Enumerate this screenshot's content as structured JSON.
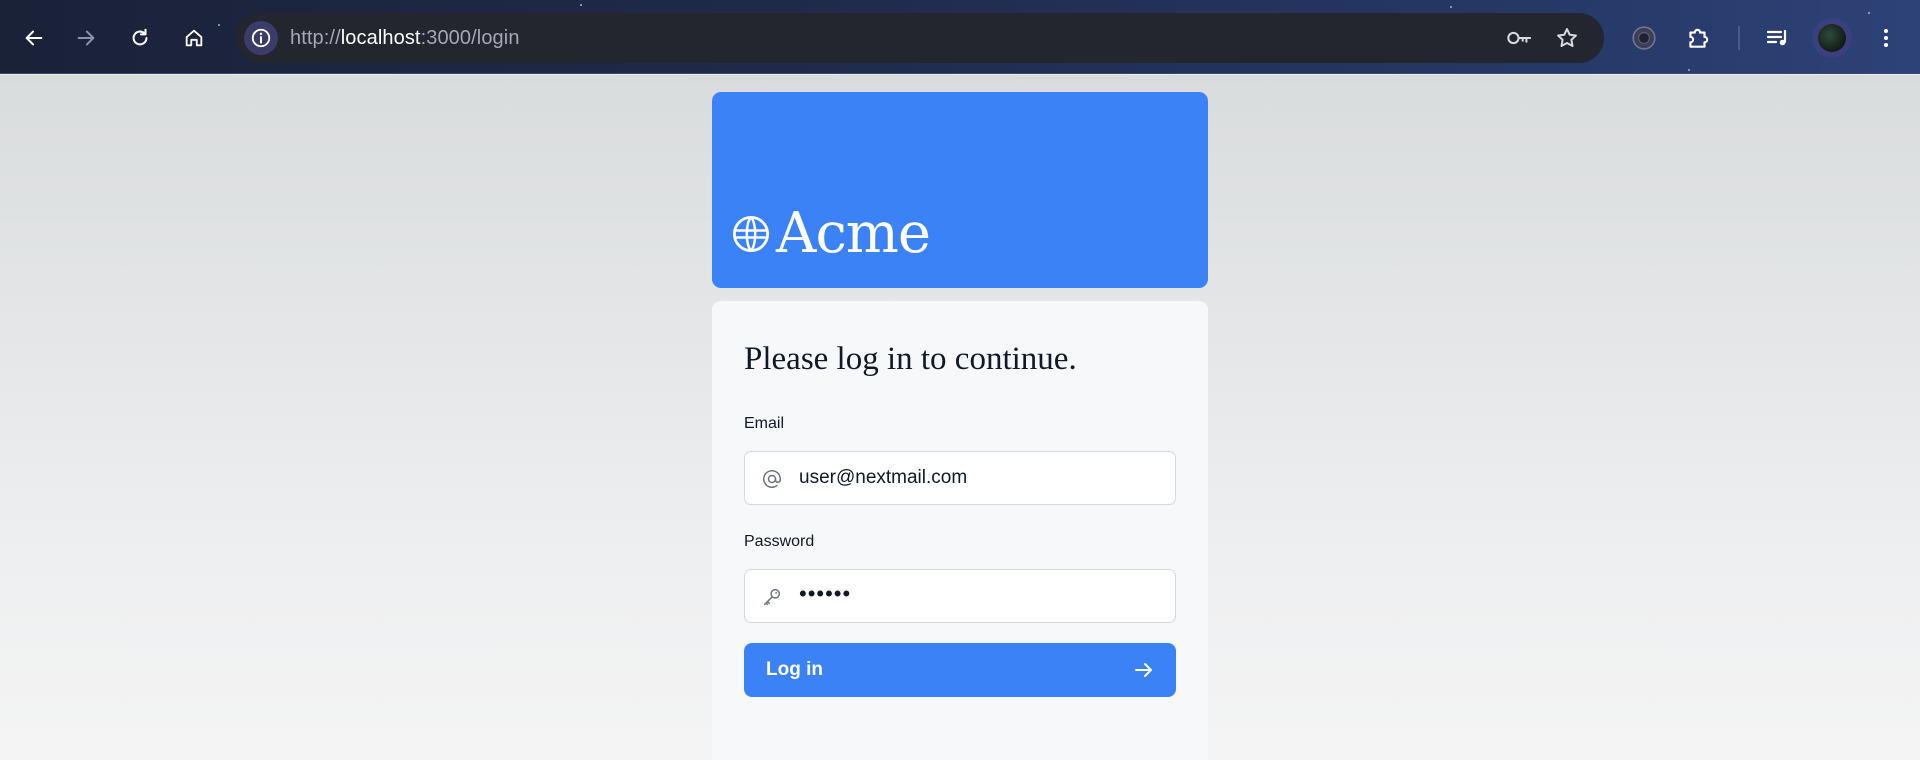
{
  "browser": {
    "url_prefix": "http://",
    "url_host": "localhost",
    "url_path": ":3000/login",
    "icons": [
      "back-arrow-icon",
      "forward-arrow-icon",
      "reload-icon",
      "home-icon",
      "site-info-icon",
      "key-icon",
      "star-icon",
      "extension-puzzle-icon",
      "media-queue-icon",
      "menu-dots-icon"
    ]
  },
  "brand": {
    "name": "Acme",
    "banner_color": "#3b82f6"
  },
  "login": {
    "heading": "Please log in to continue.",
    "email_label": "Email",
    "email_value": "user@nextmail.com",
    "password_label": "Password",
    "password_value": "••••••",
    "submit_label": "Log in"
  },
  "colors": {
    "accent": "#3b82f6",
    "card_bg": "#f7f8fa"
  }
}
